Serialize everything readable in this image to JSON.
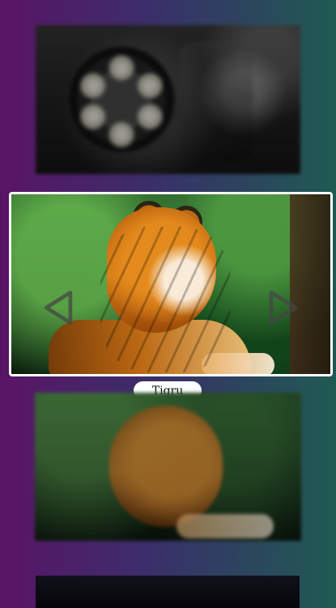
{
  "carousel": {
    "active_caption": "Tigru"
  },
  "icons": {
    "prev": "triangle-left-icon",
    "next": "triangle-right-icon"
  }
}
